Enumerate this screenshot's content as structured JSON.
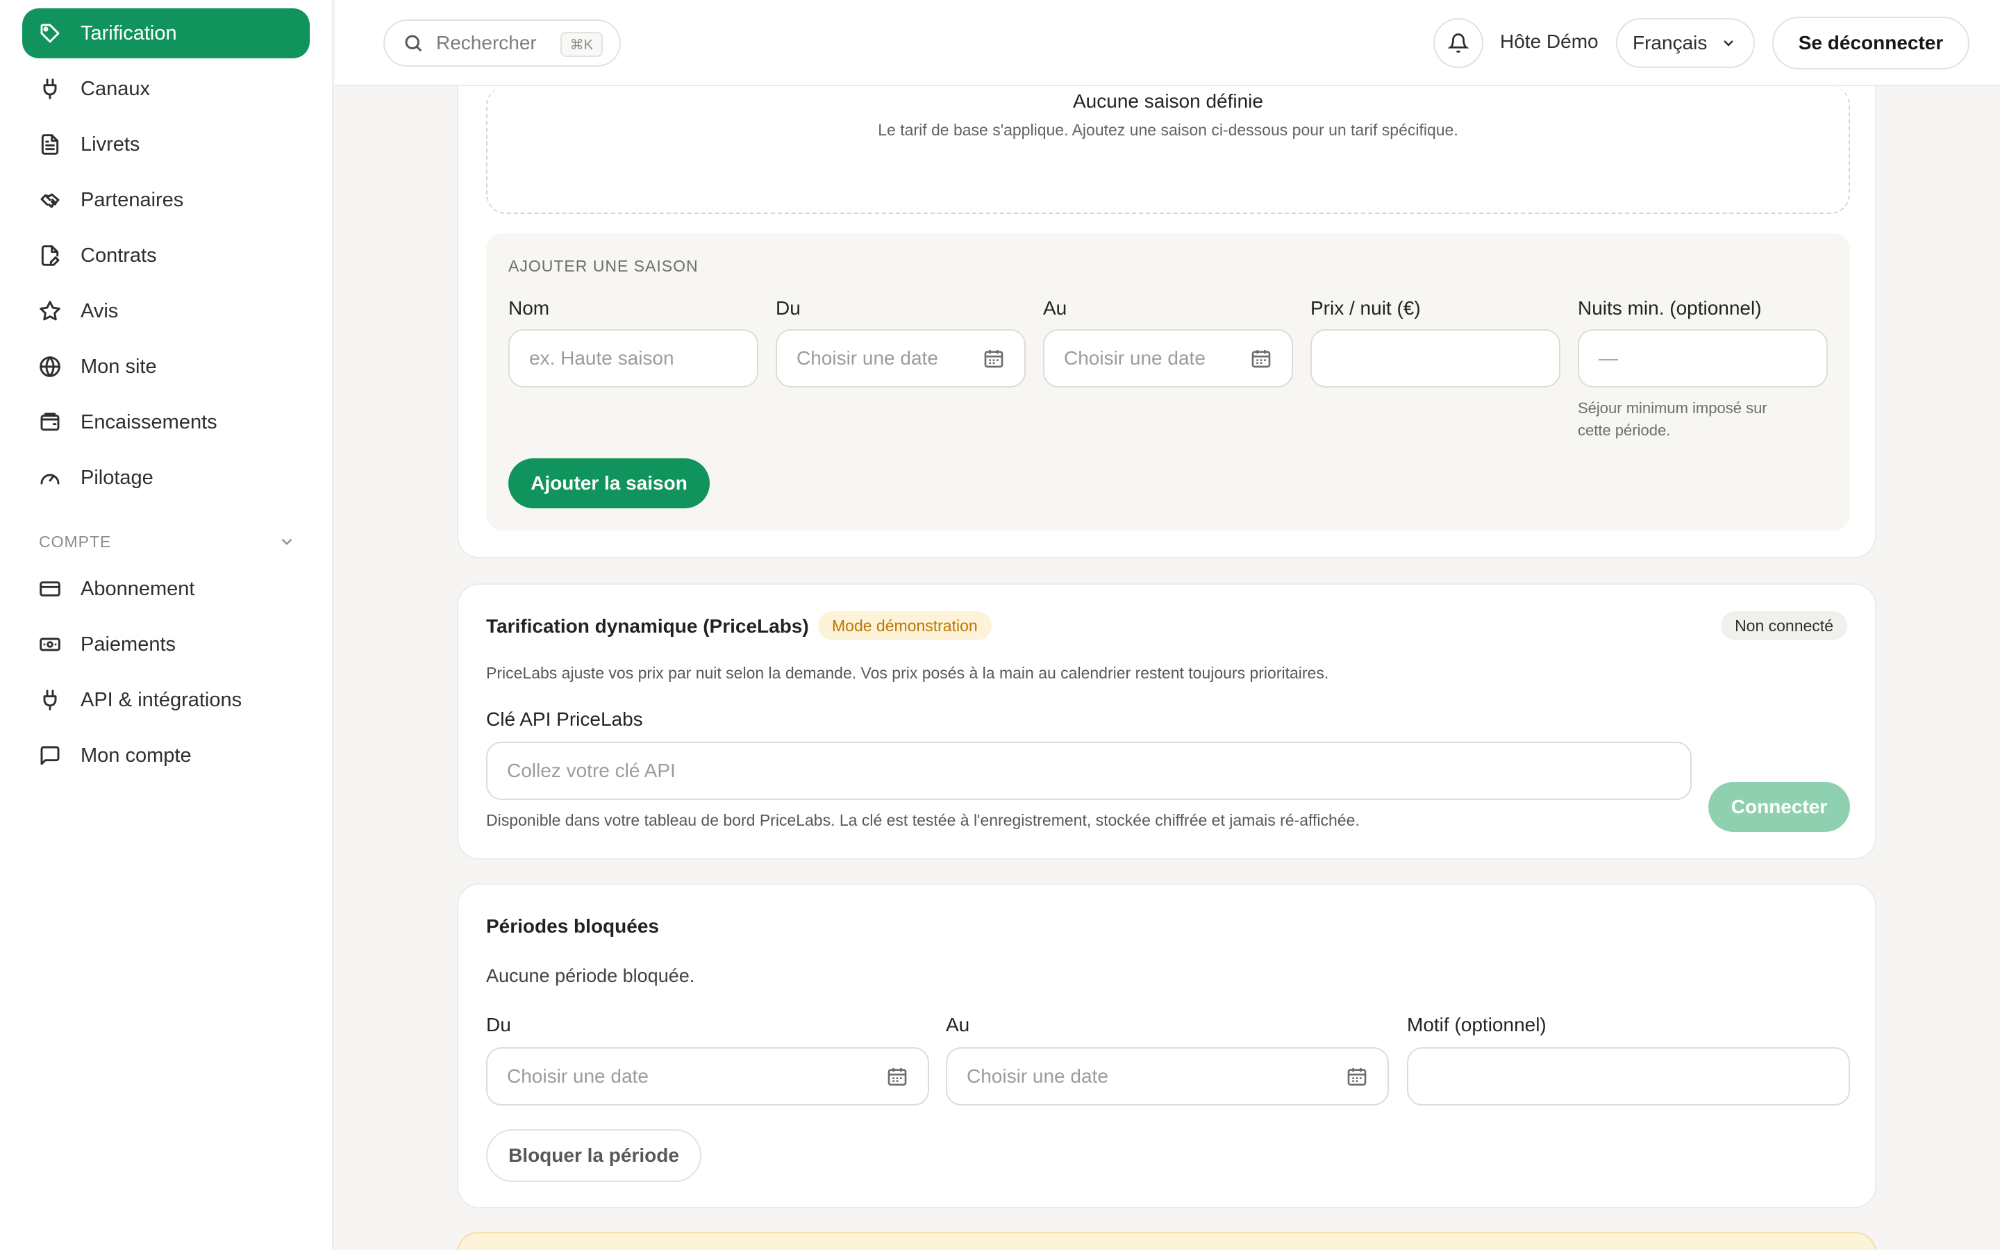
{
  "sidebar": {
    "items": [
      {
        "label": "Tarification",
        "icon": "tag-icon",
        "active": true
      },
      {
        "label": "Canaux",
        "icon": "plug-icon"
      },
      {
        "label": "Livrets",
        "icon": "document-icon"
      },
      {
        "label": "Partenaires",
        "icon": "handshake-icon"
      },
      {
        "label": "Contrats",
        "icon": "contract-icon"
      },
      {
        "label": "Avis",
        "icon": "star-icon"
      },
      {
        "label": "Mon site",
        "icon": "globe-icon"
      },
      {
        "label": "Encaissements",
        "icon": "wallet-icon"
      },
      {
        "label": "Pilotage",
        "icon": "gauge-icon"
      }
    ],
    "section_label": "COMPTE",
    "account_items": [
      {
        "label": "Abonnement",
        "icon": "credit-card-icon"
      },
      {
        "label": "Paiements",
        "icon": "banknote-icon"
      },
      {
        "label": "API & intégrations",
        "icon": "plug-icon"
      },
      {
        "label": "Mon compte",
        "icon": "chat-icon"
      }
    ]
  },
  "topbar": {
    "search_placeholder": "Rechercher",
    "search_shortcut": "⌘K",
    "host_name": "Hôte Démo",
    "language": "Français",
    "logout_label": "Se déconnecter"
  },
  "seasons": {
    "empty_title": "Aucune saison définie",
    "empty_sub": "Le tarif de base s'applique. Ajoutez une saison ci-dessous pour un tarif spécifique.",
    "add_title": "AJOUTER UNE SAISON",
    "fields": {
      "name_label": "Nom",
      "name_placeholder": "ex. Haute saison",
      "from_label": "Du",
      "from_placeholder": "Choisir une date",
      "to_label": "Au",
      "to_placeholder": "Choisir une date",
      "price_label": "Prix / nuit (€)",
      "price_value": "",
      "min_nights_label": "Nuits min. (optionnel)",
      "min_nights_placeholder": "—",
      "min_nights_hint_1": "Séjour minimum imposé sur",
      "min_nights_hint_2": "cette période."
    },
    "add_button": "Ajouter la saison"
  },
  "pricelabs": {
    "title": "Tarification dynamique (PriceLabs)",
    "demo_badge": "Mode démonstration",
    "status_badge": "Non connecté",
    "description": "PriceLabs ajuste vos prix par nuit selon la demande. Vos prix posés à la main au calendrier restent toujours prioritaires.",
    "api_label": "Clé API PriceLabs",
    "api_placeholder": "Collez votre clé API",
    "api_hint": "Disponible dans votre tableau de bord PriceLabs. La clé est testée à l'enregistrement, stockée chiffrée et jamais ré-affichée.",
    "connect_button": "Connecter"
  },
  "blocked": {
    "title": "Périodes bloquées",
    "empty_text": "Aucune période bloquée.",
    "from_label": "Du",
    "from_placeholder": "Choisir une date",
    "to_label": "Au",
    "to_placeholder": "Choisir une date",
    "reason_label": "Motif (optionnel)",
    "reason_value": "",
    "block_button": "Bloquer la période"
  },
  "colors": {
    "accent": "#10935d",
    "accent_disabled": "#8fd0b1",
    "demo_badge_bg": "#fdf3d9",
    "demo_badge_text": "#c07400"
  }
}
